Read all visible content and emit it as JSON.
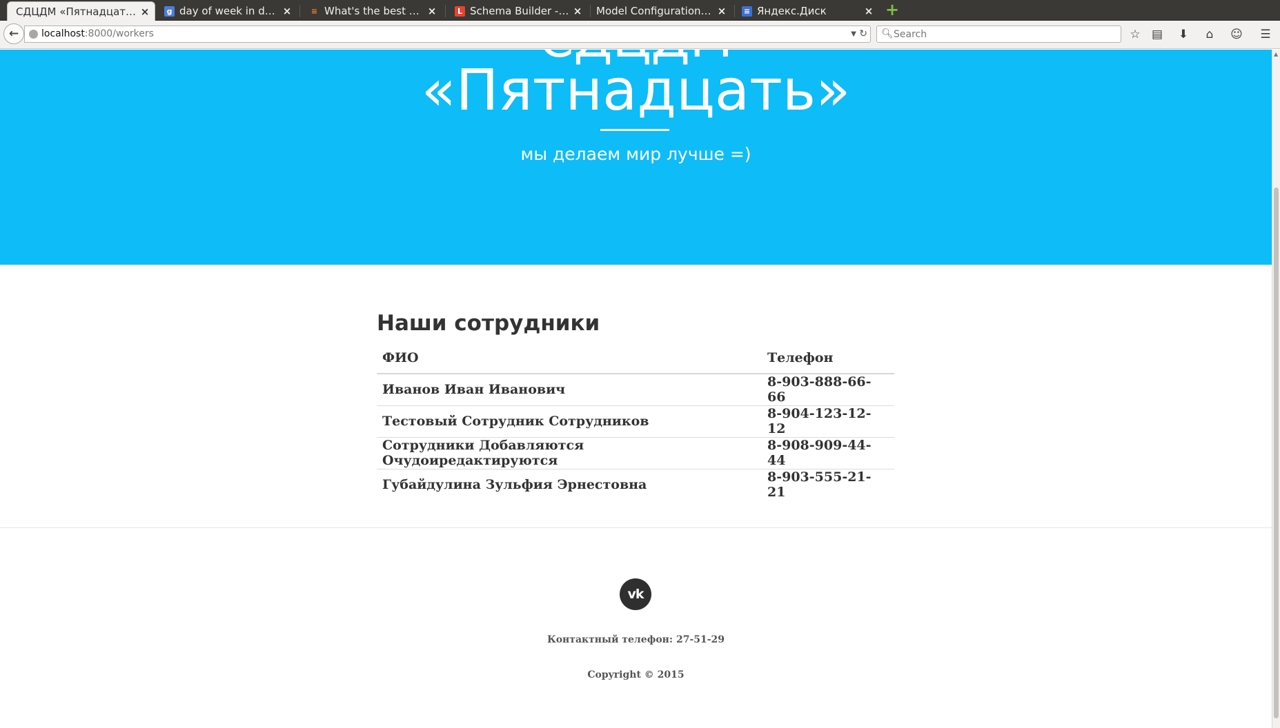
{
  "browser": {
    "tabs": [
      {
        "title": "СДЦДМ «Пятнадцать» ...",
        "favicon": "",
        "active": true
      },
      {
        "title": "day of week in db - П...",
        "favicon": "google-icon"
      },
      {
        "title": "What's the best way...",
        "favicon": "stackoverflow-icon"
      },
      {
        "title": "Schema Builder - Lar...",
        "favicon": "laravel-icon"
      },
      {
        "title": "Model Configuration G...",
        "favicon": ""
      },
      {
        "title": "Яндекс.Диск",
        "favicon": "yandex-disk-icon"
      }
    ],
    "tab_close_glyph": "×",
    "new_tab_glyph": "+",
    "url": {
      "host": "localhost",
      "path": ":8000/workers"
    },
    "search_placeholder": "Search",
    "toolbar_icons": [
      "bookmark-star-icon",
      "reading-list-icon",
      "download-icon",
      "home-icon",
      "chat-icon",
      "menu-icon"
    ]
  },
  "hero": {
    "line1": "СДЦДМ",
    "title": "«Пятнадцать»",
    "subtitle": "мы делаем мир лучше =)",
    "color": "#0ebcf7"
  },
  "workers": {
    "heading": "Наши сотрудники",
    "columns": [
      "ФИО",
      "Телефон"
    ],
    "rows": [
      [
        "Иванов Иван Иванович",
        "8-903-888-66-66"
      ],
      [
        "Тестовый Сотрудник Сотрудников",
        "8-904-123-12-12"
      ],
      [
        "Сотрудники Добавляются Очудоиредактируются",
        "8-908-909-44-44"
      ],
      [
        "Губайдулина Зульфия Эрнестовна",
        "8-903-555-21-21"
      ]
    ]
  },
  "footer": {
    "social_icon": "vk-icon",
    "social_label": "vk",
    "phone": "Контактный телефон: 27-51-29",
    "copyright": "Copyright © 2015"
  }
}
